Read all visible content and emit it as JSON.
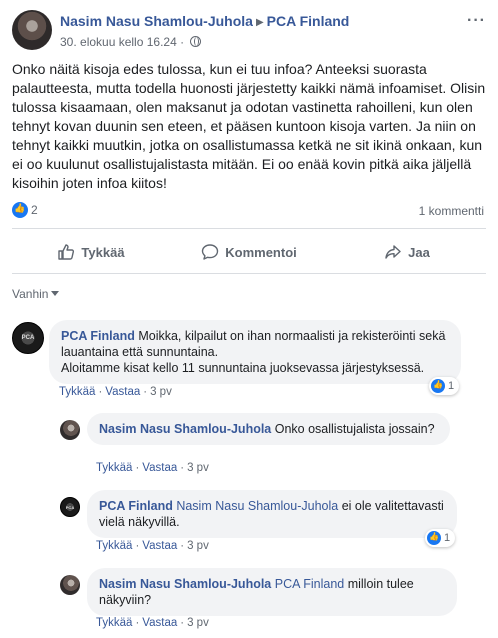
{
  "post": {
    "author": "Nasim Nasu Shamlou-Juhola",
    "target": "PCA Finland",
    "timestamp": "30. elokuu kello 16.24",
    "more": "···",
    "text": "Onko näitä kisoja edes tulossa, kun ei tuu infoa? Anteeksi suorasta palautteesta, mutta todella huonosti järjestetty kaikki nämä infoamiset. Olisin tulossa kisaamaan, olen maksanut ja odotan vastinetta rahoilleni, kun olen tehnyt kovan duunin sen eteen, et pääsen kuntoon kisoja varten. Ja niin on tehnyt kaikki muutkin, jotka on osallistumassa ketkä ne sit ikinä onkaan, kun ei oo kuulunut osallistujalistasta mitään. Ei oo enää kovin pitkä aika jäljellä kisoihin joten infoa kiitos!",
    "reaction_count": "2",
    "comment_count": "1 kommentti"
  },
  "actions": {
    "like": "Tykkää",
    "comment": "Kommentoi",
    "share": "Jaa"
  },
  "sort_label": "Vanhin",
  "comments": [
    {
      "author": "PCA Finland",
      "mention": "",
      "text": "Moikka, kilpailut on ihan normaalisti ja rekisteröinti sekä lauantaina että sunnuntaina.",
      "text2": "Aloitamme kisat kello 11 sunnuntaina juoksevassa järjestyksessä.",
      "like": "Tykkää",
      "reply": "Vastaa",
      "time": "3 pv",
      "reactions": "1",
      "avatar_label": "PCA"
    },
    {
      "author": "Nasim Nasu Shamlou-Juhola",
      "mention": "",
      "text": "Onko osallistujalista jossain?",
      "like": "Tykkää",
      "reply": "Vastaa",
      "time": "3 pv"
    },
    {
      "author": "PCA Finland",
      "mention": "Nasim Nasu Shamlou-Juhola",
      "text": "ei ole valitettavasti vielä näkyvillä.",
      "like": "Tykkää",
      "reply": "Vastaa",
      "time": "3 pv",
      "reactions": "1",
      "avatar_label": "PCA"
    },
    {
      "author": "Nasim Nasu Shamlou-Juhola",
      "mention": "PCA Finland",
      "text": "milloin tulee näkyviin?",
      "like": "Tykkää",
      "reply": "Vastaa",
      "time": "3 pv"
    }
  ],
  "colors": {
    "link": "#385898",
    "like_blue": "#1877f2",
    "bubble_bg": "#f2f3f5"
  }
}
